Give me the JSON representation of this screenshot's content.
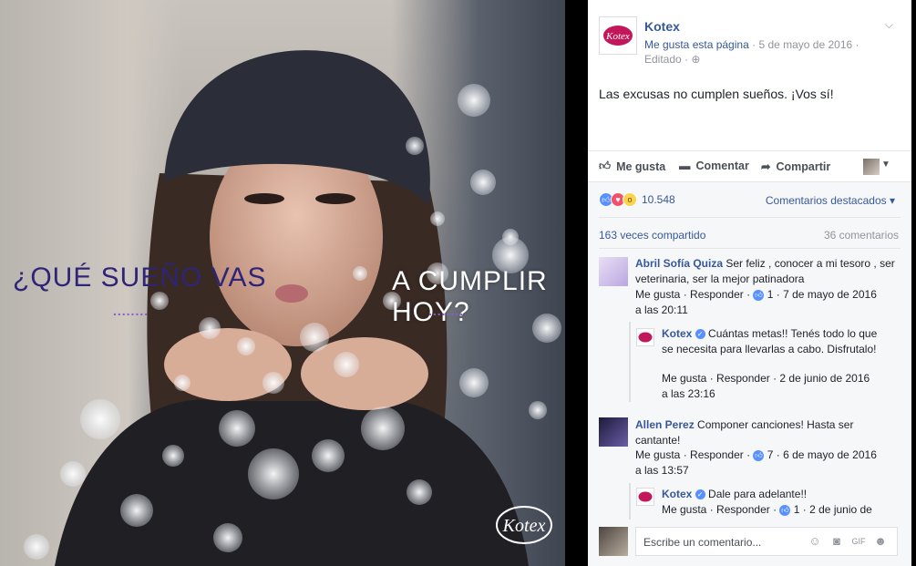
{
  "photo": {
    "headline_left": "¿QUÉ SUEÑO VAS",
    "headline_right": "A CUMPLIR HOY?",
    "dots": "........",
    "watermark_logo": "Kotex"
  },
  "post": {
    "page_name": "Kotex",
    "like_page": "Me gusta esta página",
    "date": "5 de mayo de 2016",
    "edited": "Editado",
    "globe_icon": "globe-icon",
    "text": "Las excusas no cumplen sueños. ¡Vos sí!",
    "actions": {
      "like": "Me gusta",
      "comment": "Comentar",
      "share": "Compartir"
    },
    "reactions_count": "10.548",
    "top_comments": "Comentarios destacados",
    "shares": "163 veces compartido",
    "comments_count": "36 comentarios"
  },
  "comments": [
    {
      "author": "Abril Sofía Quiza",
      "text": "Ser feliz , conocer a mi tesoro , ser veterinaria, ser la mejor patinadora",
      "like": "Me gusta",
      "reply": "Responder",
      "likes": "1",
      "date": "7 de mayo de 2016",
      "time": "a las 20:11",
      "reply_item": {
        "author": "Kotex",
        "text": "Cuántas metas!! Tenés todo lo que se necesita para llevarlas a cabo. Disfrutalo!",
        "like": "Me gusta",
        "reply": "Responder",
        "date": "2 de junio de 2016",
        "time": "a las 23:16"
      }
    },
    {
      "author": "Allen Perez",
      "text": "Componer canciones! Hasta ser cantante!",
      "like": "Me gusta",
      "reply": "Responder",
      "likes": "7",
      "date": "6 de mayo de 2016",
      "time": "a las 13:57",
      "reply_item": {
        "author": "Kotex",
        "text": "Dale para adelante!!",
        "like": "Me gusta",
        "reply": "Responder",
        "likes": "1",
        "date": "2 de junio de"
      }
    }
  ],
  "composer": {
    "placeholder": "Escribe un comentario..."
  },
  "colors": {
    "link": "#365899",
    "brand_purple": "#2f2476",
    "dots_purple": "#8a5cc8",
    "kotex_pink": "#c2185b"
  }
}
